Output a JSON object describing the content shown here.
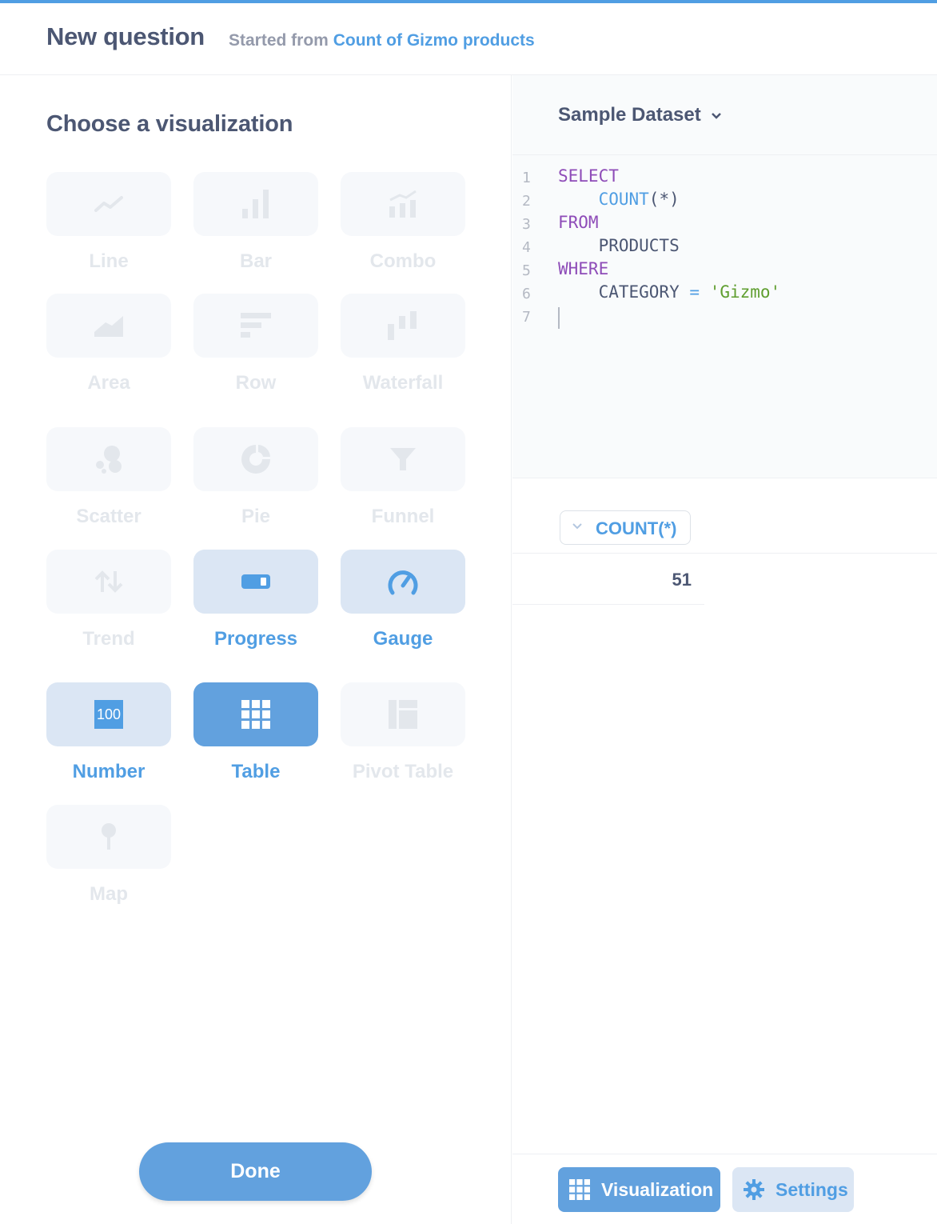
{
  "header": {
    "title": "New question",
    "started_from_prefix": "Started from",
    "started_from_link": "Count of Gizmo products"
  },
  "sidebar": {
    "heading": "Choose a visualization",
    "visualizations": [
      {
        "label": "Line",
        "icon": "line-chart-icon",
        "state": "disabled"
      },
      {
        "label": "Bar",
        "icon": "bar-chart-icon",
        "state": "disabled"
      },
      {
        "label": "Combo",
        "icon": "combo-chart-icon",
        "state": "disabled"
      },
      {
        "label": "Area",
        "icon": "area-chart-icon",
        "state": "disabled"
      },
      {
        "label": "Row",
        "icon": "row-chart-icon",
        "state": "disabled"
      },
      {
        "label": "Waterfall",
        "icon": "waterfall-chart-icon",
        "state": "disabled"
      },
      {
        "label": "Scatter",
        "icon": "scatter-chart-icon",
        "state": "disabled"
      },
      {
        "label": "Pie",
        "icon": "pie-chart-icon",
        "state": "disabled"
      },
      {
        "label": "Funnel",
        "icon": "funnel-icon",
        "state": "disabled"
      },
      {
        "label": "Trend",
        "icon": "trend-icon",
        "state": "disabled"
      },
      {
        "label": "Progress",
        "icon": "progress-icon",
        "state": "sensible"
      },
      {
        "label": "Gauge",
        "icon": "gauge-icon",
        "state": "sensible"
      },
      {
        "label": "Number",
        "icon": "number-icon",
        "state": "sensible",
        "icon_text": "100"
      },
      {
        "label": "Table",
        "icon": "table-icon",
        "state": "selected"
      },
      {
        "label": "Pivot Table",
        "icon": "pivot-table-icon",
        "state": "disabled"
      },
      {
        "label": "Map",
        "icon": "map-pin-icon",
        "state": "disabled"
      }
    ],
    "done_label": "Done"
  },
  "editor": {
    "database": "Sample Dataset",
    "lines": [
      {
        "n": "1",
        "parts": [
          {
            "t": "SELECT",
            "c": "kw"
          }
        ]
      },
      {
        "n": "2",
        "parts": [
          {
            "t": "    ",
            "c": ""
          },
          {
            "t": "COUNT",
            "c": "fn"
          },
          {
            "t": "(*)",
            "c": ""
          }
        ]
      },
      {
        "n": "3",
        "parts": [
          {
            "t": "FROM",
            "c": "kw"
          }
        ]
      },
      {
        "n": "4",
        "parts": [
          {
            "t": "    PRODUCTS",
            "c": ""
          }
        ]
      },
      {
        "n": "5",
        "parts": [
          {
            "t": "WHERE",
            "c": "kw"
          }
        ]
      },
      {
        "n": "6",
        "parts": [
          {
            "t": "    CATEGORY ",
            "c": ""
          },
          {
            "t": "=",
            "c": "fn"
          },
          {
            "t": " ",
            "c": ""
          },
          {
            "t": "'Gizmo'",
            "c": "str"
          }
        ]
      },
      {
        "n": "7",
        "parts": []
      }
    ]
  },
  "results": {
    "column": "COUNT(*)",
    "rows": [
      "51"
    ]
  },
  "footer": {
    "visualization_label": "Visualization",
    "settings_label": "Settings"
  },
  "colors": {
    "brand": "#509ee3",
    "selected_tile": "#62a1de",
    "sensible_tile": "#dbe6f4",
    "disabled_tile": "#f6f8fb",
    "keyword": "#8e4cb8",
    "string": "#5f9e2f"
  }
}
